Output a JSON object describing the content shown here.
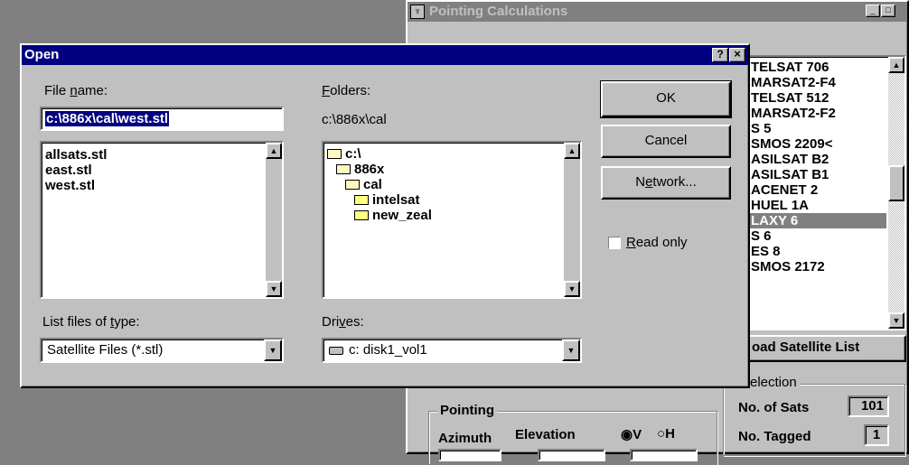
{
  "background_window": {
    "title": "Pointing Calculations",
    "satellite_list": [
      "TELSAT 706",
      "MARSAT2-F4",
      "TELSAT 512",
      "MARSAT2-F2",
      "S 5",
      "SMOS 2209<",
      "ASILSAT B2",
      "ASILSAT B1",
      "ACENET 2",
      "HUEL 1A",
      "LAXY 6",
      "S 6",
      "ES 8",
      "SMOS 2172"
    ],
    "selected_index": 10,
    "load_button": "oad Satellite List",
    "selection_group": "election",
    "no_of_sats_label": "No. of Sats",
    "no_of_sats_value": "101",
    "no_tagged_label": "No. Tagged",
    "no_tagged_value": "1",
    "pointing_group": "Pointing",
    "azimuth_label": "Azimuth",
    "elevation_label": "Elevation",
    "radio_v": "V",
    "radio_h": "H"
  },
  "dialog": {
    "title": "Open",
    "help_btn": "?",
    "close_btn": "×",
    "file_name_label_pre": "File ",
    "file_name_label_key": "n",
    "file_name_label_post": "ame:",
    "file_name_value": "c:\\886x\\cal\\west.stl",
    "files": [
      "allsats.stl",
      "east.stl",
      "west.stl"
    ],
    "folders_label_key": "F",
    "folders_label_post": "olders:",
    "current_folder": "c:\\886x\\cal",
    "folder_tree": [
      {
        "name": "c:\\",
        "indent": 0,
        "open": true
      },
      {
        "name": "886x",
        "indent": 1,
        "open": true
      },
      {
        "name": "cal",
        "indent": 2,
        "open": true
      },
      {
        "name": "intelsat",
        "indent": 3,
        "open": false
      },
      {
        "name": "new_zeal",
        "indent": 3,
        "open": false
      }
    ],
    "ok": "OK",
    "cancel": "Cancel",
    "network_pre": "N",
    "network_key": "e",
    "network_post": "twork...",
    "readonly_key": "R",
    "readonly_post": "ead only",
    "list_type_pre": "List files of ",
    "list_type_key": "t",
    "list_type_post": "ype:",
    "list_type_value": "Satellite Files (*.stl)",
    "drives_pre": "Dri",
    "drives_key": "v",
    "drives_post": "es:",
    "drive_value": "c: disk1_vol1"
  }
}
